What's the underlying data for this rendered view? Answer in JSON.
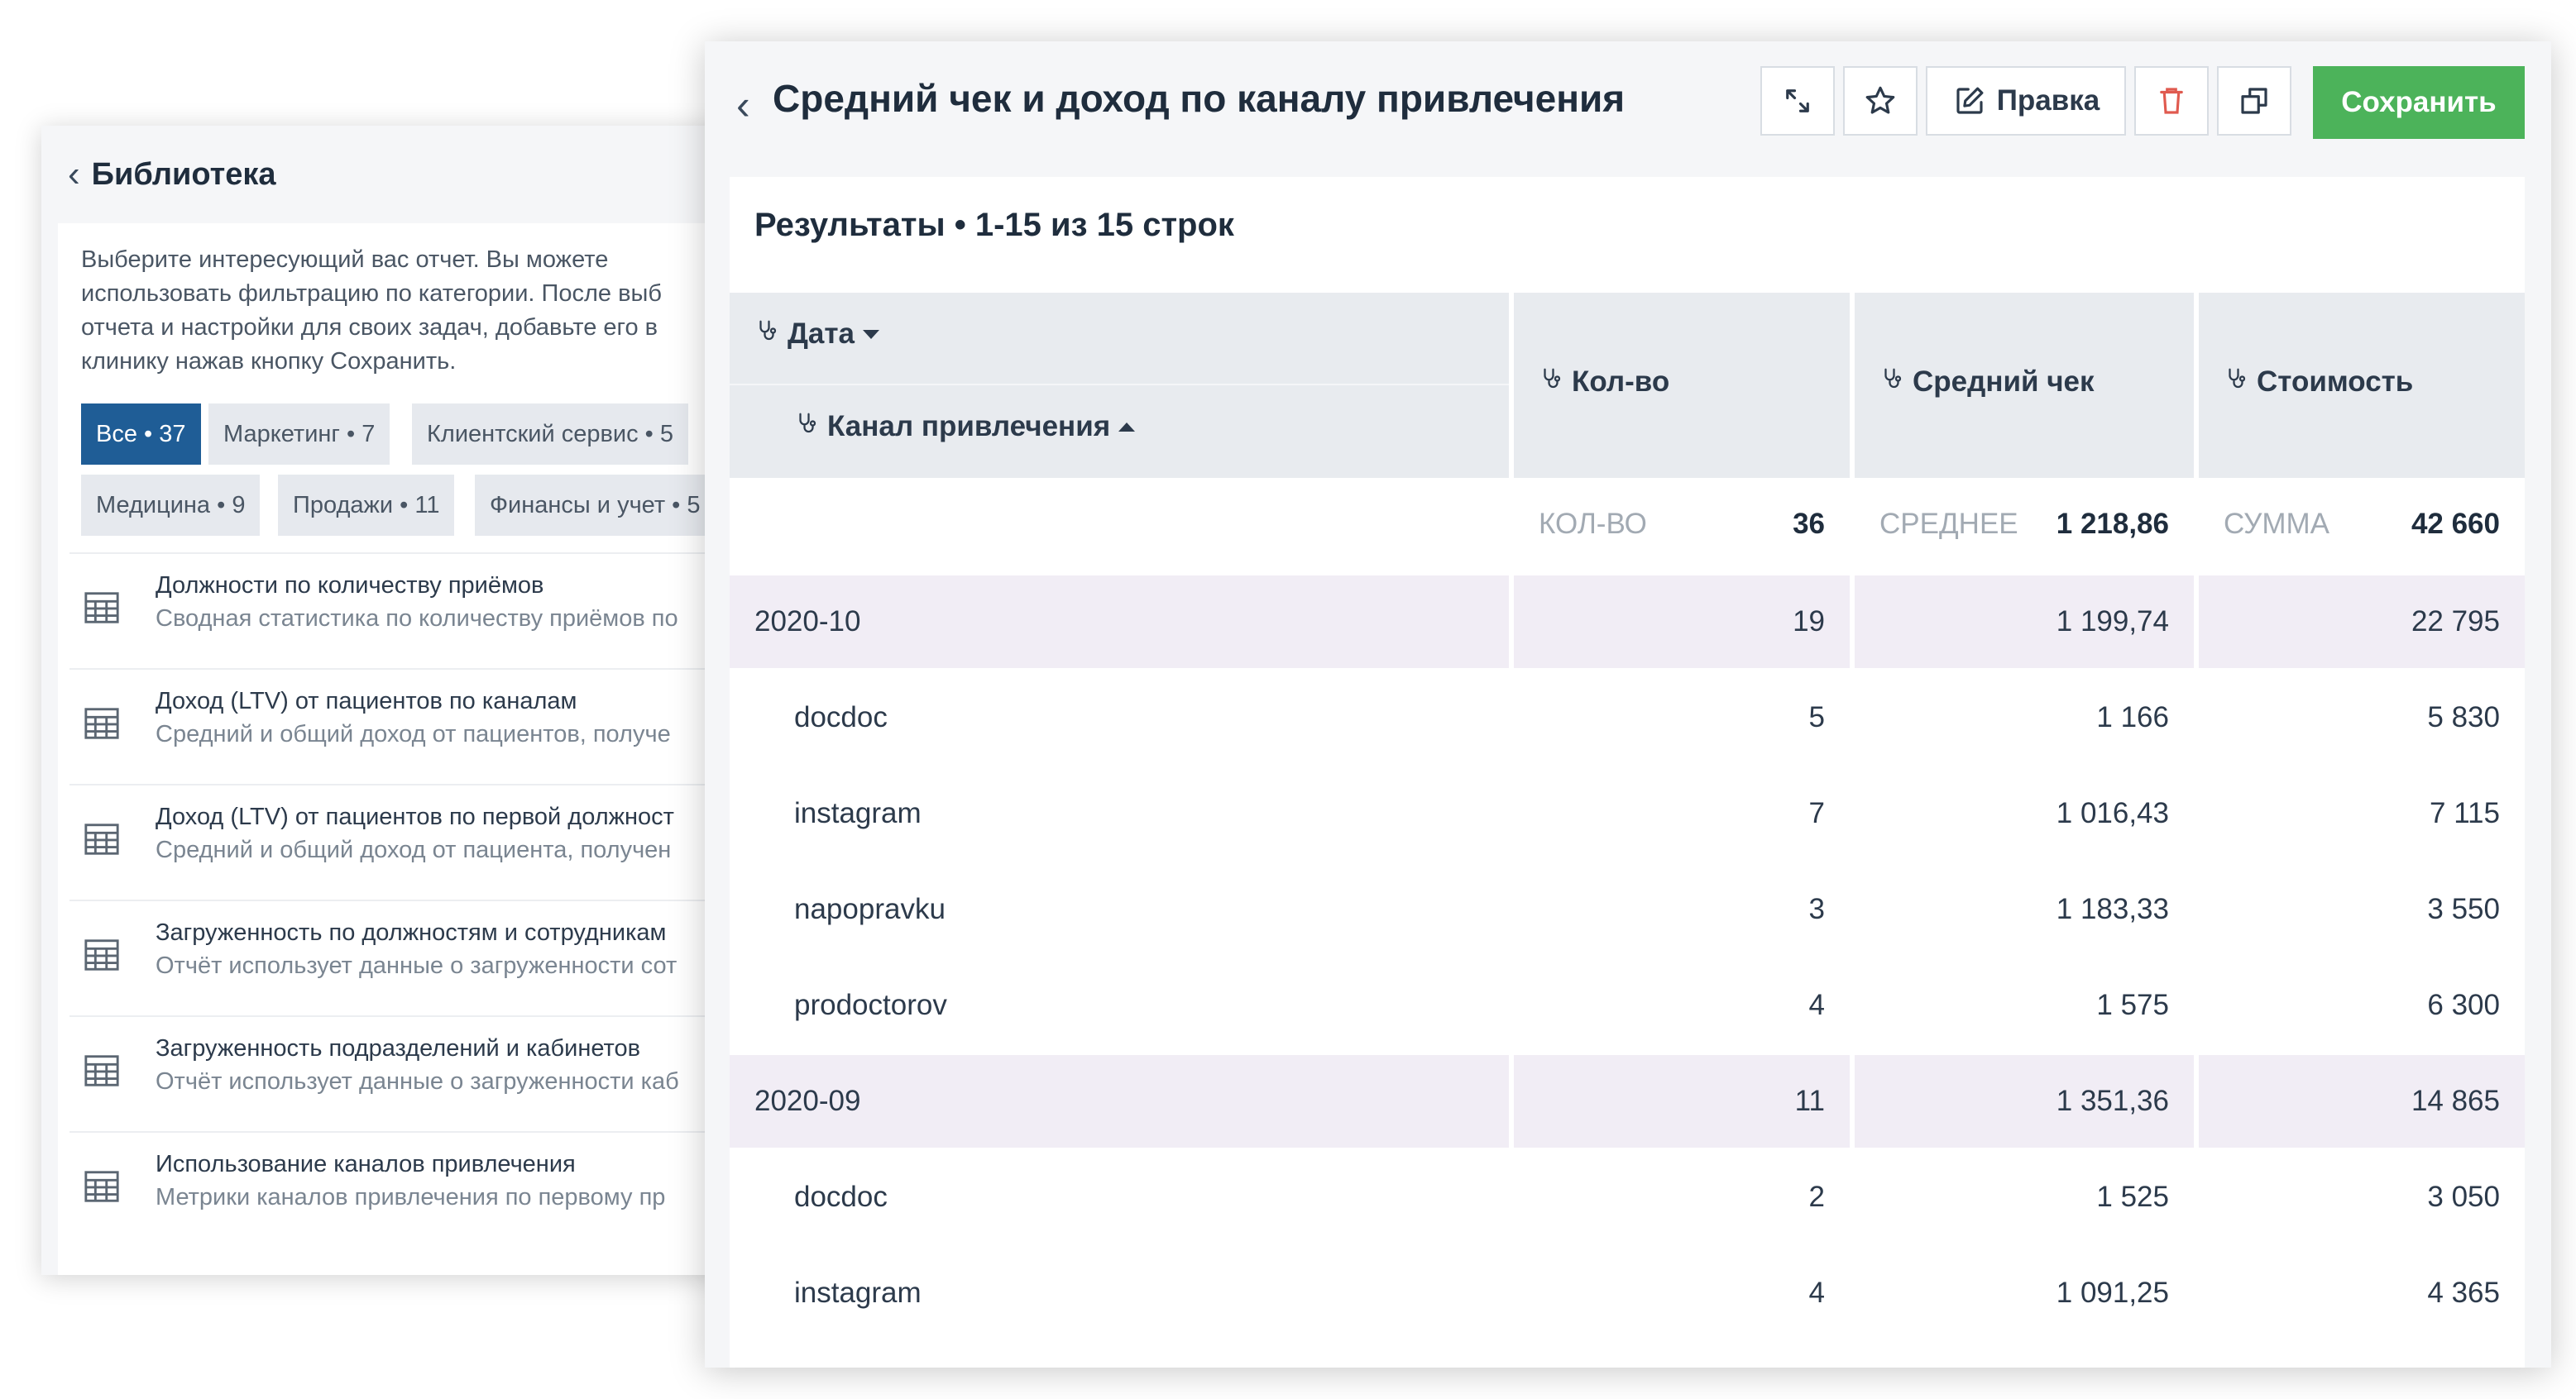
{
  "library": {
    "back_label": "Библиотека",
    "description": "Выберите интересующий вас отчет. Вы можете\nиспользовать фильтрацию по категории. После выб\nотчета и настройки для своих задач, добавьте его в\nклинику нажав кнопку Сохранить.",
    "categories": [
      {
        "label": "Все • 37",
        "active": true
      },
      {
        "label": "Маркетинг • 7",
        "active": false
      },
      {
        "label": "Клиентский сервис • 5",
        "active": false
      },
      {
        "label": "Медицина • 9",
        "active": false
      },
      {
        "label": "Продажи • 11",
        "active": false
      },
      {
        "label": "Финансы и учет • 5",
        "active": false
      }
    ],
    "reports": [
      {
        "title": "Должности по количеству приёмов",
        "desc": "Сводная статистика по количеству приёмов по"
      },
      {
        "title": "Доход (LTV) от пациентов по каналам",
        "desc": "Средний и общий доход от пациентов, получе"
      },
      {
        "title": "Доход (LTV) от пациентов по первой должност",
        "desc": "Средний и общий доход от пациента, получен"
      },
      {
        "title": "Загруженность по должностям и сотрудникам",
        "desc": "Отчёт использует данные о загруженности сот"
      },
      {
        "title": "Загруженность подразделений и кабинетов",
        "desc": "Отчёт использует данные о загруженности каб"
      },
      {
        "title": "Использование каналов привлечения",
        "desc": "Метрики каналов привлечения по первому пр"
      }
    ]
  },
  "report": {
    "title": "Средний чек и доход по каналу привлечения",
    "toolbar": {
      "expand_icon": "expand-icon",
      "favorite_icon": "star-icon",
      "edit_label": "Правка",
      "delete_icon": "trash-icon",
      "copy_icon": "copy-icon",
      "save_label": "Сохранить",
      "save_color": "#4cb35a",
      "delete_color": "#e05a4f"
    },
    "results_title": "Результаты • 1-15 из 15 строк",
    "columns": {
      "date": "Дата",
      "channel": "Канал привлечения",
      "count": "Кол-во",
      "avg_check": "Средний чек",
      "cost": "Стоимость"
    },
    "aggregates": {
      "count_label": "КОЛ-ВО",
      "count_value": "36",
      "avg_label": "СРЕДНЕЕ",
      "avg_value": "1 218,86",
      "sum_label": "СУММА",
      "sum_value": "42 660"
    },
    "rows": [
      {
        "type": "group",
        "name": "2020-10",
        "count": "19",
        "avg": "1 199,74",
        "cost": "22 795"
      },
      {
        "type": "item",
        "name": "docdoc",
        "count": "5",
        "avg": "1 166",
        "cost": "5 830"
      },
      {
        "type": "item",
        "name": "instagram",
        "count": "7",
        "avg": "1 016,43",
        "cost": "7 115"
      },
      {
        "type": "item",
        "name": "napopravku",
        "count": "3",
        "avg": "1 183,33",
        "cost": "3 550"
      },
      {
        "type": "item",
        "name": "prodoctorov",
        "count": "4",
        "avg": "1 575",
        "cost": "6 300"
      },
      {
        "type": "group",
        "name": "2020-09",
        "count": "11",
        "avg": "1 351,36",
        "cost": "14 865"
      },
      {
        "type": "item",
        "name": "docdoc",
        "count": "2",
        "avg": "1 525",
        "cost": "3 050"
      },
      {
        "type": "item",
        "name": "instagram",
        "count": "4",
        "avg": "1 091,25",
        "cost": "4 365"
      }
    ]
  }
}
